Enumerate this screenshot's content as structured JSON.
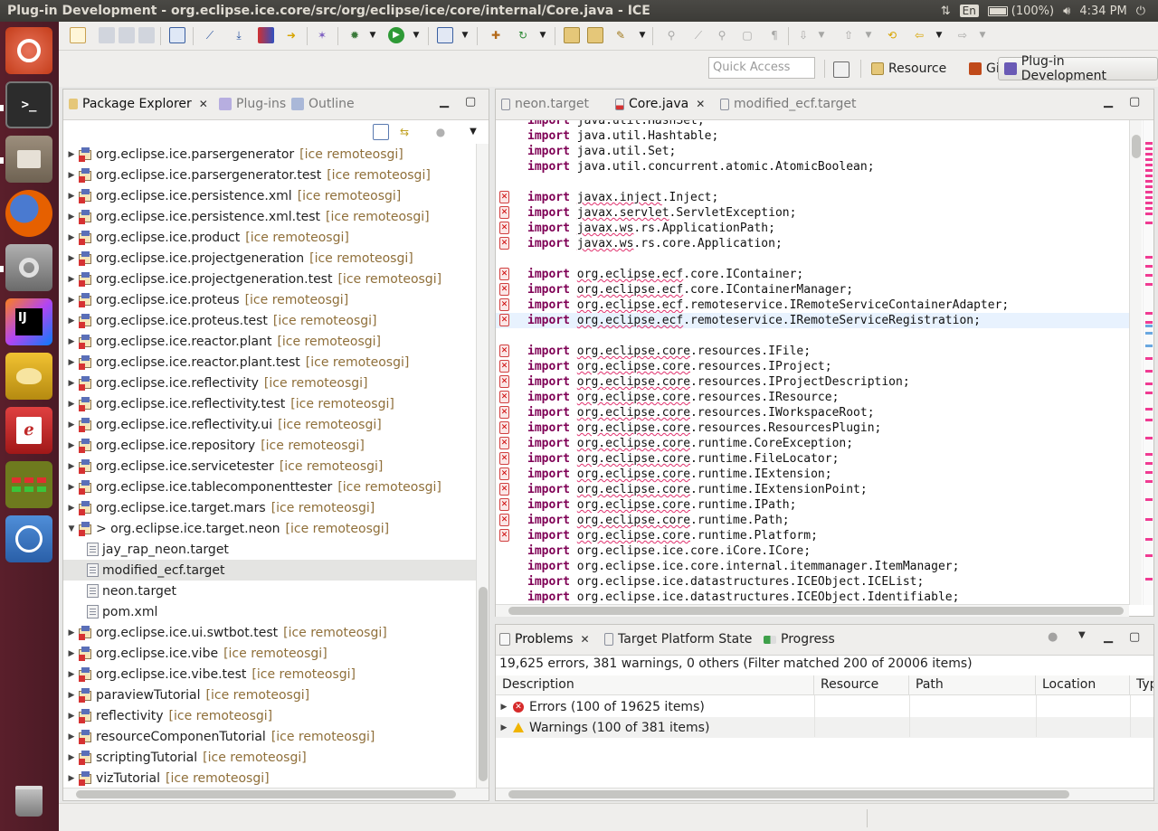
{
  "window": {
    "title": "Plug-in Development - org.eclipse.ice.core/src/org/eclipse/ice/core/internal/Core.java - ICE"
  },
  "tray": {
    "keyboard": "En",
    "battery": "(100%)",
    "clock": "4:34 PM"
  },
  "launcher": {
    "items": [
      {
        "name": "ubuntu-dash-icon",
        "color": "#d9542c"
      },
      {
        "name": "terminal-icon",
        "color": "#2c2c2c"
      },
      {
        "name": "file-manager-icon",
        "color": "#8a7a66"
      },
      {
        "name": "firefox-icon",
        "color": "#e66000"
      },
      {
        "name": "system-settings-icon",
        "color": "#8c8c8c"
      },
      {
        "name": "intellij-icon",
        "color": "#3a3a6a"
      },
      {
        "name": "genie-lamp-icon",
        "color": "#d4a21c"
      },
      {
        "name": "pdf-reader-icon",
        "color": "#c02a2a"
      },
      {
        "name": "dots-app-icon",
        "color": "#7a8a1a"
      },
      {
        "name": "jenkins-icon",
        "color": "#3b78c5"
      }
    ],
    "trash": "trash-icon"
  },
  "toolbar2": {
    "quick_access_placeholder": "Quick Access",
    "perspectives": [
      "Resource",
      "Git",
      "Plug-in Development"
    ]
  },
  "package_explorer": {
    "tabs": [
      "Package Explorer",
      "Plug-ins",
      "Outline"
    ],
    "rows": [
      {
        "name": "org.eclipse.ice.parsergenerator",
        "tag": "[ice remoteosgi]",
        "kind": "project"
      },
      {
        "name": "org.eclipse.ice.parsergenerator.test",
        "tag": "[ice remoteosgi]",
        "kind": "project"
      },
      {
        "name": "org.eclipse.ice.persistence.xml",
        "tag": "[ice remoteosgi]",
        "kind": "project"
      },
      {
        "name": "org.eclipse.ice.persistence.xml.test",
        "tag": "[ice remoteosgi]",
        "kind": "project"
      },
      {
        "name": "org.eclipse.ice.product",
        "tag": "[ice remoteosgi]",
        "kind": "project"
      },
      {
        "name": "org.eclipse.ice.projectgeneration",
        "tag": "[ice remoteosgi]",
        "kind": "project"
      },
      {
        "name": "org.eclipse.ice.projectgeneration.test",
        "tag": "[ice remoteosgi]",
        "kind": "project"
      },
      {
        "name": "org.eclipse.ice.proteus",
        "tag": "[ice remoteosgi]",
        "kind": "project"
      },
      {
        "name": "org.eclipse.ice.proteus.test",
        "tag": "[ice remoteosgi]",
        "kind": "project"
      },
      {
        "name": "org.eclipse.ice.reactor.plant",
        "tag": "[ice remoteosgi]",
        "kind": "project"
      },
      {
        "name": "org.eclipse.ice.reactor.plant.test",
        "tag": "[ice remoteosgi]",
        "kind": "project"
      },
      {
        "name": "org.eclipse.ice.reflectivity",
        "tag": "[ice remoteosgi]",
        "kind": "project"
      },
      {
        "name": "org.eclipse.ice.reflectivity.test",
        "tag": "[ice remoteosgi]",
        "kind": "project"
      },
      {
        "name": "org.eclipse.ice.reflectivity.ui",
        "tag": "[ice remoteosgi]",
        "kind": "project"
      },
      {
        "name": "org.eclipse.ice.repository",
        "tag": "[ice remoteosgi]",
        "kind": "project"
      },
      {
        "name": "org.eclipse.ice.servicetester",
        "tag": "[ice remoteosgi]",
        "kind": "project"
      },
      {
        "name": "org.eclipse.ice.tablecomponenttester",
        "tag": "[ice remoteosgi]",
        "kind": "project"
      },
      {
        "name": "org.eclipse.ice.target.mars",
        "tag": "[ice remoteosgi]",
        "kind": "project"
      },
      {
        "name": "> org.eclipse.ice.target.neon",
        "tag": "[ice remoteosgi]",
        "kind": "project-open"
      },
      {
        "name": "jay_rap_neon.target",
        "tag": "",
        "kind": "file"
      },
      {
        "name": "modified_ecf.target",
        "tag": "",
        "kind": "file-selected"
      },
      {
        "name": "neon.target",
        "tag": "",
        "kind": "file"
      },
      {
        "name": "pom.xml",
        "tag": "",
        "kind": "file"
      },
      {
        "name": "org.eclipse.ice.ui.swtbot.test",
        "tag": "[ice remoteosgi]",
        "kind": "project"
      },
      {
        "name": "org.eclipse.ice.vibe",
        "tag": "[ice remoteosgi]",
        "kind": "project"
      },
      {
        "name": "org.eclipse.ice.vibe.test",
        "tag": "[ice remoteosgi]",
        "kind": "project"
      },
      {
        "name": "paraviewTutorial",
        "tag": "[ice remoteosgi]",
        "kind": "project"
      },
      {
        "name": "reflectivity",
        "tag": "[ice remoteosgi]",
        "kind": "project"
      },
      {
        "name": "resourceComponenTutorial",
        "tag": "[ice remoteosgi]",
        "kind": "project"
      },
      {
        "name": "scriptingTutorial",
        "tag": "[ice remoteosgi]",
        "kind": "project"
      },
      {
        "name": "vizTutorial",
        "tag": "[ice remoteosgi]",
        "kind": "project"
      }
    ]
  },
  "editor": {
    "tabs": [
      "neon.target",
      "Core.java",
      "modified_ecf.target"
    ],
    "active_tab": "Core.java",
    "lines": [
      {
        "kw": "import",
        "pre": "",
        "err": "",
        "post": "java.util.HashSet;",
        "mark": false
      },
      {
        "kw": "import",
        "pre": "",
        "err": "",
        "post": "java.util.Hashtable;",
        "mark": false
      },
      {
        "kw": "import",
        "pre": "",
        "err": "",
        "post": "java.util.Set;",
        "mark": false
      },
      {
        "kw": "import",
        "pre": "",
        "err": "",
        "post": "java.util.concurrent.atomic.AtomicBoolean;",
        "mark": false
      },
      {
        "kw": "",
        "pre": "",
        "err": "",
        "post": "",
        "mark": false
      },
      {
        "kw": "import",
        "pre": "",
        "err": "javax.inject",
        "post": ".Inject;",
        "mark": true
      },
      {
        "kw": "import",
        "pre": "",
        "err": "javax.servlet",
        "post": ".ServletException;",
        "mark": true
      },
      {
        "kw": "import",
        "pre": "",
        "err": "javax.ws",
        "post": ".rs.ApplicationPath;",
        "mark": true
      },
      {
        "kw": "import",
        "pre": "",
        "err": "javax.ws",
        "post": ".rs.core.Application;",
        "mark": true
      },
      {
        "kw": "",
        "pre": "",
        "err": "",
        "post": "",
        "mark": false
      },
      {
        "kw": "import",
        "pre": "",
        "err": "org.eclipse.ecf",
        "post": ".core.IContainer;",
        "mark": true
      },
      {
        "kw": "import",
        "pre": "",
        "err": "org.eclipse.ecf",
        "post": ".core.IContainerManager;",
        "mark": true
      },
      {
        "kw": "import",
        "pre": "",
        "err": "org.eclipse.ecf",
        "post": ".remoteservice.IRemoteServiceContainerAdapter;",
        "mark": true
      },
      {
        "kw": "import",
        "pre": "",
        "err": "org.eclipse.ecf",
        "post": ".remoteservice.IRemoteServiceRegistration;",
        "mark": true
      },
      {
        "kw": "",
        "pre": "",
        "err": "",
        "post": "",
        "mark": false
      },
      {
        "kw": "import",
        "pre": "",
        "err": "org.eclipse.core",
        "post": ".resources.IFile;",
        "mark": true
      },
      {
        "kw": "import",
        "pre": "",
        "err": "org.eclipse.core",
        "post": ".resources.IProject;",
        "mark": true
      },
      {
        "kw": "import",
        "pre": "",
        "err": "org.eclipse.core",
        "post": ".resources.IProjectDescription;",
        "mark": true
      },
      {
        "kw": "import",
        "pre": "",
        "err": "org.eclipse.core",
        "post": ".resources.IResource;",
        "mark": true
      },
      {
        "kw": "import",
        "pre": "",
        "err": "org.eclipse.core",
        "post": ".resources.IWorkspaceRoot;",
        "mark": true
      },
      {
        "kw": "import",
        "pre": "",
        "err": "org.eclipse.core",
        "post": ".resources.ResourcesPlugin;",
        "mark": true
      },
      {
        "kw": "import",
        "pre": "",
        "err": "org.eclipse.core",
        "post": ".runtime.CoreException;",
        "mark": true
      },
      {
        "kw": "import",
        "pre": "",
        "err": "org.eclipse.core",
        "post": ".runtime.FileLocator;",
        "mark": true
      },
      {
        "kw": "import",
        "pre": "",
        "err": "org.eclipse.core",
        "post": ".runtime.IExtension;",
        "mark": true
      },
      {
        "kw": "import",
        "pre": "",
        "err": "org.eclipse.core",
        "post": ".runtime.IExtensionPoint;",
        "mark": true
      },
      {
        "kw": "import",
        "pre": "",
        "err": "org.eclipse.core",
        "post": ".runtime.IPath;",
        "mark": true
      },
      {
        "kw": "import",
        "pre": "",
        "err": "org.eclipse.core",
        "post": ".runtime.Path;",
        "mark": true
      },
      {
        "kw": "import",
        "pre": "",
        "err": "org.eclipse.core",
        "post": ".runtime.Platform;",
        "mark": true
      },
      {
        "kw": "import",
        "pre": "",
        "err": "",
        "post": "org.eclipse.ice.core.iCore.ICore;",
        "mark": false
      },
      {
        "kw": "import",
        "pre": "",
        "err": "",
        "post": "org.eclipse.ice.core.internal.itemmanager.ItemManager;",
        "mark": false
      },
      {
        "kw": "import",
        "pre": "",
        "err": "",
        "post": "org.eclipse.ice.datastructures.ICEObject.ICEList;",
        "mark": false
      },
      {
        "kw": "import",
        "pre": "",
        "err": "",
        "post": "org.eclipse.ice.datastructures.ICEObject.Identifiable;",
        "mark": false
      }
    ],
    "current_line": 13
  },
  "problems": {
    "tabs": [
      "Problems",
      "Target Platform State",
      "Progress"
    ],
    "summary": "19,625 errors, 381 warnings, 0 others (Filter matched 200 of 20006 items)",
    "columns": [
      "Description",
      "Resource",
      "Path",
      "Location",
      "Typ"
    ],
    "rows": [
      {
        "label": "Errors (100 of 19625 items)",
        "kind": "error"
      },
      {
        "label": "Warnings (100 of 381 items)",
        "kind": "warning"
      }
    ]
  },
  "colors": {
    "accent": "#7f0055",
    "error": "#d62a2a",
    "warning": "#f0b400",
    "tag": "#8f6f3a"
  }
}
